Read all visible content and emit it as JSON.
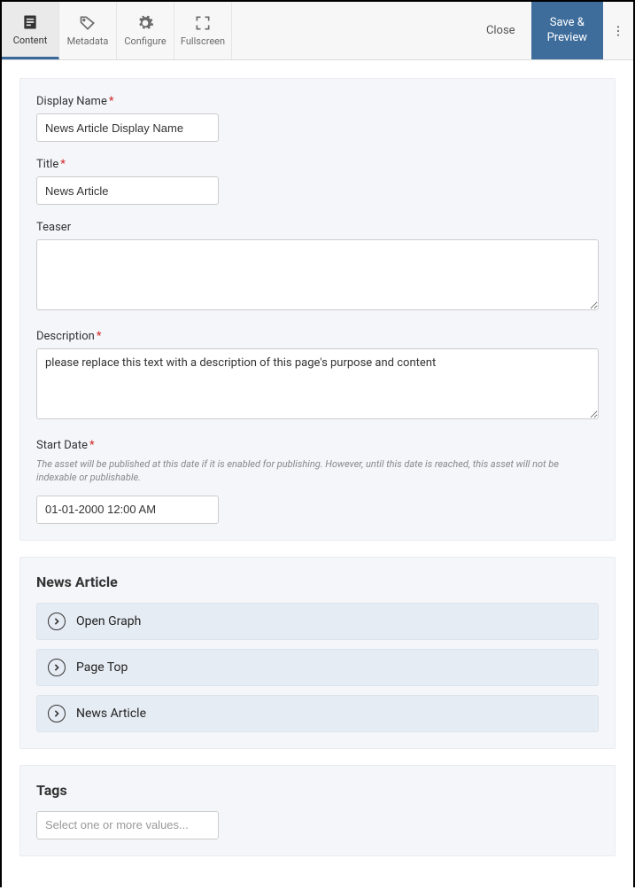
{
  "toolbar": {
    "tabs": [
      {
        "label": "Content"
      },
      {
        "label": "Metadata"
      },
      {
        "label": "Configure"
      },
      {
        "label": "Fullscreen"
      }
    ],
    "close_label": "Close",
    "save_label": "Save &\nPreview"
  },
  "fields": {
    "display_name": {
      "label": "Display Name",
      "required": true,
      "value": "News Article Display Name"
    },
    "title": {
      "label": "Title",
      "required": true,
      "value": "News Article"
    },
    "teaser": {
      "label": "Teaser",
      "required": false,
      "value": ""
    },
    "description": {
      "label": "Description",
      "required": true,
      "value": "please replace this text with a description of this page's purpose and content"
    },
    "start_date": {
      "label": "Start Date",
      "required": true,
      "help": "The asset will be published at this date if it is enabled for publishing. However, until this date is reached, this asset will not be indexable or publishable.",
      "value": "01-01-2000 12:00 AM"
    }
  },
  "news_section": {
    "heading": "News Article",
    "rows": [
      {
        "label": "Open Graph"
      },
      {
        "label": "Page Top"
      },
      {
        "label": "News Article"
      }
    ]
  },
  "tags_section": {
    "heading": "Tags",
    "placeholder": "Select one or more values..."
  }
}
